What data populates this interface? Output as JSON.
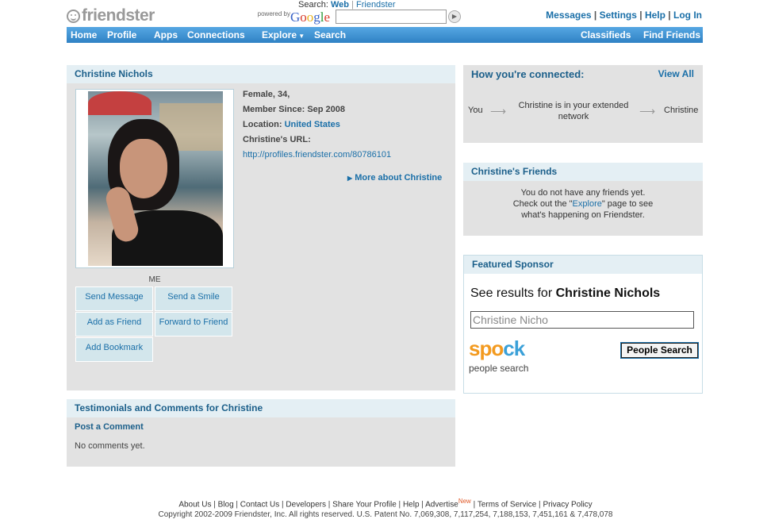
{
  "header": {
    "logo": "friendster",
    "search_label": "Search:",
    "search_web": "Web",
    "search_sep": "|",
    "search_friendster": "Friendster",
    "powered_by": "powered by",
    "google": [
      "G",
      "o",
      "o",
      "g",
      "l",
      "e"
    ],
    "search_value": "",
    "toplinks": [
      "Messages",
      "Settings",
      "Help",
      "Log In"
    ]
  },
  "nav": {
    "left": [
      "Home",
      "Profile",
      "Apps",
      "Connections",
      "Explore",
      "Search"
    ],
    "right": [
      "Classifieds",
      "Find Friends"
    ]
  },
  "profile": {
    "name": "Christine Nichols",
    "gender_age": "Female, 34,",
    "member_since_label": "Member Since:",
    "member_since": "Sep 2008",
    "location_label": "Location:",
    "location": "United States",
    "url_label": "Christine's URL:",
    "url": "http://profiles.friendster.com/80786101",
    "more_about": "More about Christine",
    "photo_caption": "ME",
    "actions": [
      "Send Message",
      "Send a Smile",
      "Add as Friend",
      "Forward to Friend",
      "Add Bookmark"
    ]
  },
  "testimonials": {
    "title": "Testimonials and Comments for Christine",
    "post_comment": "Post a Comment",
    "empty": "No comments yet."
  },
  "connected": {
    "title": "How you're connected:",
    "view_all": "View All",
    "you": "You",
    "middle": "Christine is in your extended network",
    "christine": "Christine"
  },
  "friends": {
    "title": "Christine's Friends",
    "line1": "You do not have any friends yet.",
    "line2_pre": "Check out the \"",
    "line2_link": "Explore",
    "line2_post": "\" page to see",
    "line3": "what's happening on Friendster."
  },
  "sponsor": {
    "title": "Featured Sponsor",
    "see_results": "See results for",
    "query_name": "Christine Nichols",
    "input_value": "Christine Nicho",
    "button": "People Search",
    "logo": "spock",
    "logo_sub": "people search"
  },
  "footer": {
    "links": [
      "About Us",
      "Blog",
      "Contact Us",
      "Developers",
      "Share Your Profile",
      "Help",
      "Advertise",
      "Terms of Service",
      "Privacy Policy"
    ],
    "new_badge": "New",
    "copyright": "Copyright 2002-2009 Friendster, Inc. All rights reserved. U.S. Patent No. 7,069,308, 7,117,254, 7,188,153, 7,451,161 & 7,478,078"
  },
  "colors": {
    "nav_blue": "#3d92d4",
    "link_blue": "#1a6fa8",
    "panel_gray": "#e2e2e2",
    "header_tint": "#e4eff4",
    "spock_orange": "#f39a1f",
    "spock_blue": "#3aa0d8"
  },
  "icons": [
    "smiley-logo-icon",
    "search-go-icon",
    "explore-dropdown-icon",
    "more-arrow-icon",
    "connection-arrow-icon"
  ]
}
